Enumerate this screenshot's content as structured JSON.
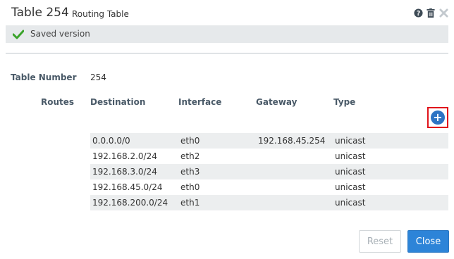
{
  "header": {
    "title": "Table 254",
    "subtitle": "Routing Table",
    "icons": [
      "help-icon",
      "trash-icon",
      "close-icon"
    ]
  },
  "status": {
    "text": "Saved version",
    "icon": "checkmark-icon",
    "color": "#3aa32a"
  },
  "form": {
    "table_number_label": "Table Number",
    "table_number_value": "254",
    "routes_label": "Routes"
  },
  "routes": {
    "columns": [
      "Destination",
      "Interface",
      "Gateway",
      "Type"
    ],
    "rows": [
      {
        "destination": "0.0.0.0/0",
        "interface": "eth0",
        "gateway": "192.168.45.254",
        "type": "unicast"
      },
      {
        "destination": "192.168.2.0/24",
        "interface": "eth2",
        "gateway": "",
        "type": "unicast"
      },
      {
        "destination": "192.168.3.0/24",
        "interface": "eth3",
        "gateway": "",
        "type": "unicast"
      },
      {
        "destination": "192.168.45.0/24",
        "interface": "eth0",
        "gateway": "",
        "type": "unicast"
      },
      {
        "destination": "192.168.200.0/24",
        "interface": "eth1",
        "gateway": "",
        "type": "unicast"
      }
    ],
    "add_label": "+"
  },
  "footer": {
    "reset_label": "Reset",
    "close_label": "Close"
  },
  "colors": {
    "accent": "#2d84d8",
    "highlight": "#e0141b"
  }
}
